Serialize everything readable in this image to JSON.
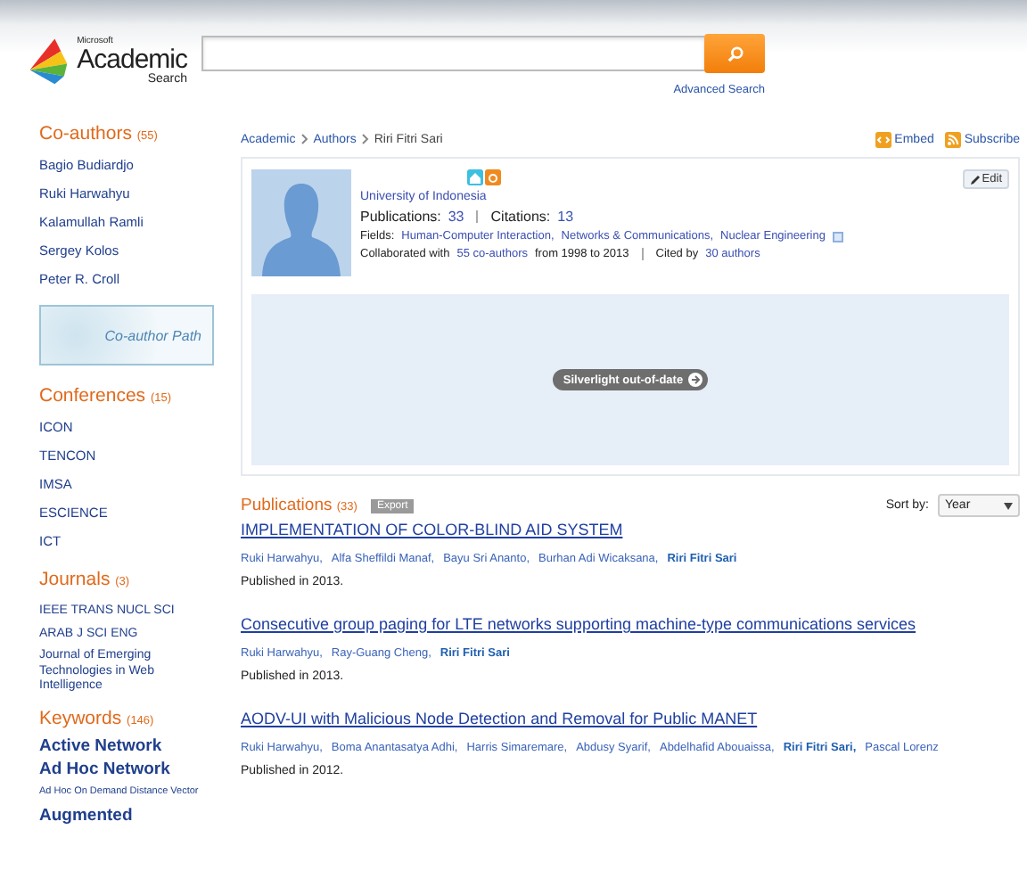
{
  "header": {
    "logo": {
      "brand": "Microsoft",
      "name": "Academic",
      "sub": "Search"
    },
    "advanced_search": "Advanced Search"
  },
  "sidebar": {
    "coauthors": {
      "title": "Co-authors",
      "count": "(55)",
      "items": [
        "Bagio Budiardjo",
        "Ruki Harwahyu",
        "Kalamullah Ramli",
        "Sergey Kolos",
        "Peter R. Croll"
      ],
      "path_button": "Co-author Path"
    },
    "conferences": {
      "title": "Conferences",
      "count": "(15)",
      "items": [
        "ICON",
        "TENCON",
        "IMSA",
        "ESCIENCE",
        "ICT"
      ]
    },
    "journals": {
      "title": "Journals",
      "count": "(3)",
      "items": [
        "IEEE TRANS NUCL SCI",
        "ARAB J SCI ENG",
        "Journal of Emerging Technologies in Web Intelligence"
      ]
    },
    "keywords": {
      "title": "Keywords",
      "count": "(146)",
      "items": [
        {
          "label": "Active Network",
          "kind": "major"
        },
        {
          "label": "Ad Hoc Network",
          "kind": "major"
        },
        {
          "label": "Ad Hoc On Demand Distance Vector",
          "kind": "minor"
        },
        {
          "label": "Augmented",
          "kind": "major"
        }
      ]
    }
  },
  "breadcrumb": [
    "Academic",
    "Authors",
    "Riri Fitri Sari"
  ],
  "actions": [
    "Embed",
    "Subscribe"
  ],
  "profile": {
    "edit": "Edit",
    "affiliation": "University of Indonesia",
    "publications_label": "Publications:",
    "publications": "33",
    "citations_label": "Citations:",
    "citations": "13",
    "fields_label": "Fields:",
    "fields": [
      "Human-Computer Interaction,",
      "Networks & Communications,",
      "Nuclear Engineering"
    ],
    "collab_prefix": "Collaborated with",
    "collab_link": "55 co-authors",
    "collab_range": "from 1998 to 2013",
    "cited_prefix": "Cited by",
    "cited_link": "30 authors",
    "silverlight": "Silverlight out-of-date"
  },
  "publications": {
    "title": "Publications",
    "count": "(33)",
    "export": "Export",
    "sort_label": "Sort by:",
    "sort_value": "Year",
    "items": [
      {
        "title": "IMPLEMENTATION OF COLOR-BLIND AID SYSTEM",
        "authors": [
          {
            "name": "Ruki Harwahyu,",
            "highlighted": false
          },
          {
            "name": "Alfa Sheffildi Manaf,",
            "highlighted": false
          },
          {
            "name": "Bayu Sri Ananto,",
            "highlighted": false
          },
          {
            "name": "Burhan Adi Wicaksana,",
            "highlighted": false
          },
          {
            "name": "Riri Fitri Sari",
            "highlighted": true
          }
        ],
        "published": "Published in 2013."
      },
      {
        "title": "Consecutive group paging for LTE networks supporting machine-type communications services",
        "authors": [
          {
            "name": "Ruki Harwahyu,",
            "highlighted": false
          },
          {
            "name": "Ray-Guang Cheng,",
            "highlighted": false
          },
          {
            "name": "Riri Fitri Sari",
            "highlighted": true
          }
        ],
        "published": "Published in 2013."
      },
      {
        "title": "AODV-UI with Malicious Node Detection and Removal for Public MANET",
        "authors": [
          {
            "name": "Ruki Harwahyu,",
            "highlighted": false
          },
          {
            "name": "Boma Anantasatya Adhi,",
            "highlighted": false
          },
          {
            "name": "Harris Simaremare,",
            "highlighted": false
          },
          {
            "name": "Abdusy Syarif,",
            "highlighted": false
          },
          {
            "name": "Abdelhafid Abouaissa,",
            "highlighted": false
          },
          {
            "name": "Riri Fitri Sari,",
            "highlighted": true
          },
          {
            "name": "Pascal Lorenz",
            "highlighted": false
          }
        ],
        "published": "Published in 2012."
      }
    ]
  }
}
